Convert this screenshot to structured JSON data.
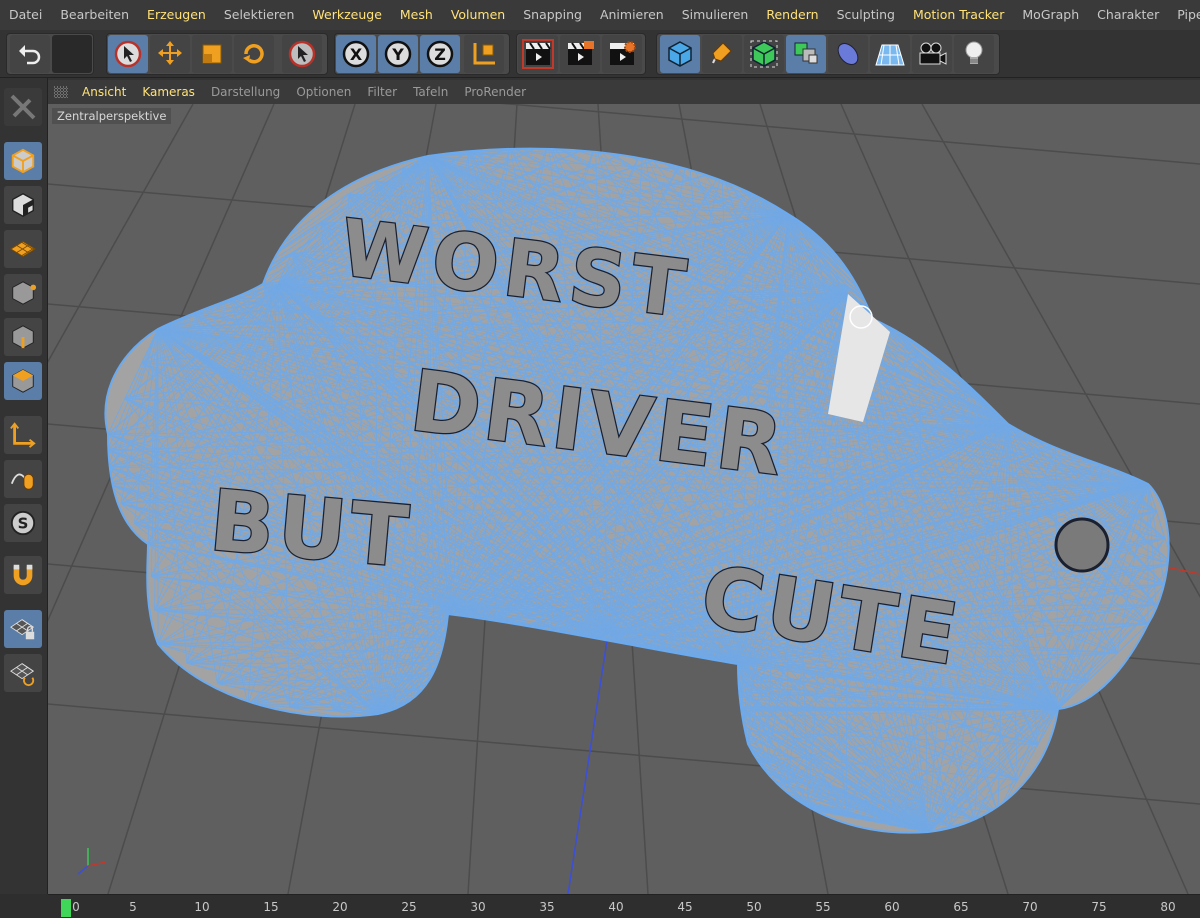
{
  "menubar": {
    "items": [
      {
        "label": "Datei",
        "highlight": false
      },
      {
        "label": "Bearbeiten",
        "highlight": false
      },
      {
        "label": "Erzeugen",
        "highlight": true
      },
      {
        "label": "Selektieren",
        "highlight": false
      },
      {
        "label": "Werkzeuge",
        "highlight": true
      },
      {
        "label": "Mesh",
        "highlight": true
      },
      {
        "label": "Volumen",
        "highlight": true
      },
      {
        "label": "Snapping",
        "highlight": false
      },
      {
        "label": "Animieren",
        "highlight": false
      },
      {
        "label": "Simulieren",
        "highlight": false
      },
      {
        "label": "Rendern",
        "highlight": true
      },
      {
        "label": "Sculpting",
        "highlight": false
      },
      {
        "label": "Motion Tracker",
        "highlight": true
      },
      {
        "label": "MoGraph",
        "highlight": false
      },
      {
        "label": "Charakter",
        "highlight": false
      },
      {
        "label": "Pipelin",
        "highlight": false
      }
    ]
  },
  "toolbar": {
    "axis_x": "X",
    "axis_y": "Y",
    "axis_z": "Z"
  },
  "viewport_menu": {
    "items": [
      {
        "label": "Ansicht",
        "highlight": true
      },
      {
        "label": "Kameras",
        "highlight": true
      },
      {
        "label": "Darstellung",
        "highlight": false
      },
      {
        "label": "Optionen",
        "highlight": false
      },
      {
        "label": "Filter",
        "highlight": false
      },
      {
        "label": "Tafeln",
        "highlight": false
      },
      {
        "label": "ProRender",
        "highlight": false
      }
    ]
  },
  "viewport": {
    "label": "Zentralperspektive",
    "text_line1": "WORST",
    "text_line2": "DRIVER",
    "text_line3a": "BUT",
    "text_line3b": "CUTE"
  },
  "timeline": {
    "ticks": [
      "0",
      "5",
      "10",
      "15",
      "20",
      "25",
      "30",
      "35",
      "40",
      "45",
      "50",
      "55",
      "60",
      "65",
      "70",
      "75",
      "80"
    ]
  },
  "colors": {
    "wire": "#6aaaf0",
    "mesh_fill": "#9a9a9a",
    "grid": "#4a4a4a",
    "accent": "#5a7ea8",
    "menu_highlight": "#ffe27a",
    "timeline_marker": "#3fd65a"
  }
}
